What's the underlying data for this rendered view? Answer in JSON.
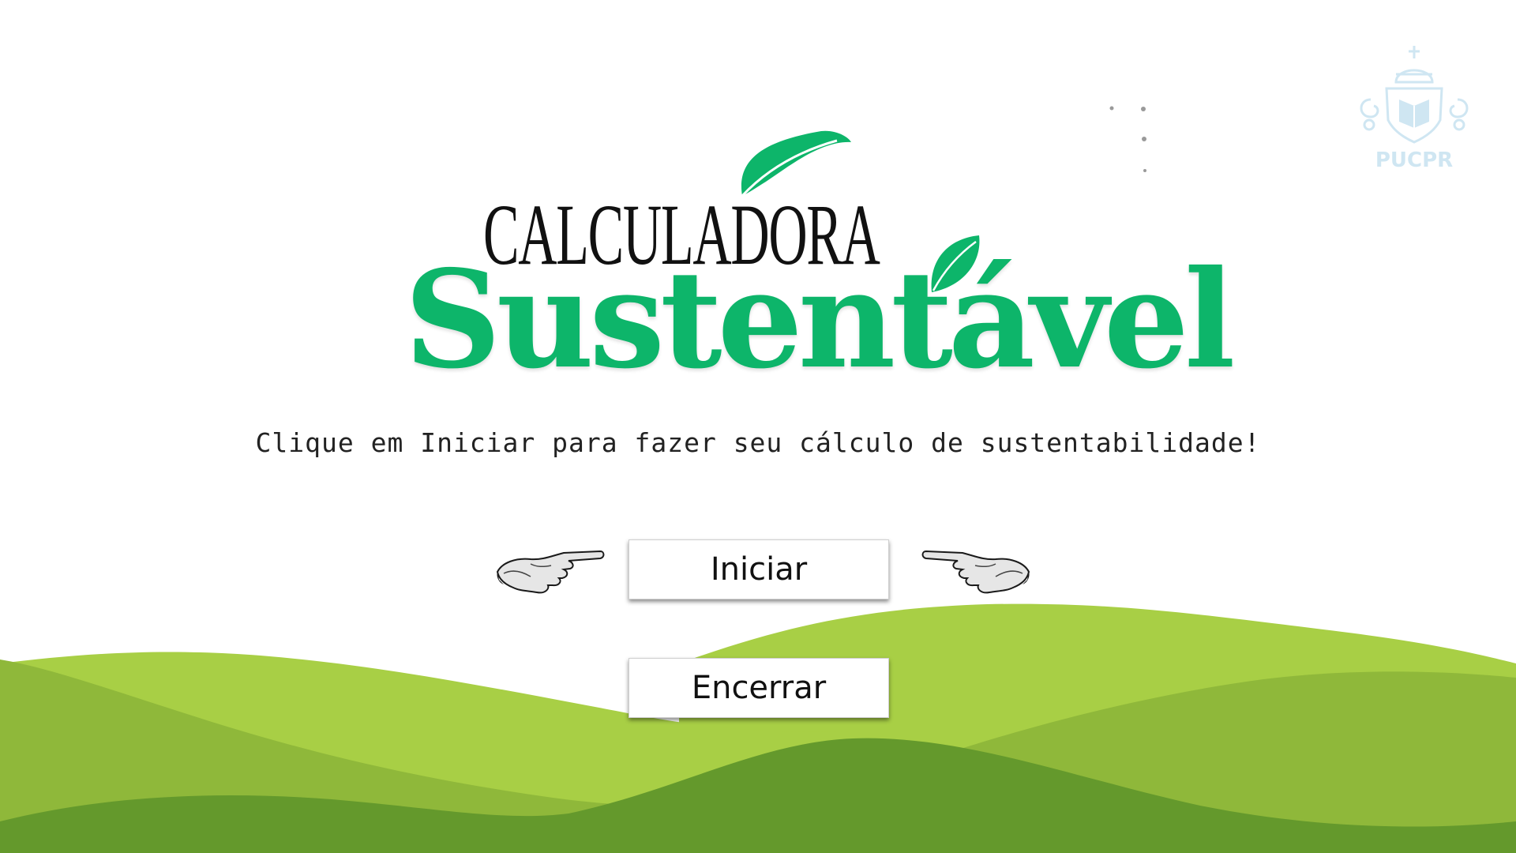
{
  "logo": {
    "line1": "CALCULADORA",
    "line2": "Sustentável"
  },
  "subtitle": "Clique em Iniciar para fazer seu cálculo de sustentabilidade!",
  "buttons": {
    "start_label": "Iniciar",
    "end_label": "Encerrar"
  },
  "emblem": {
    "label": "PUCPR"
  },
  "colors": {
    "brand_green": "#0db56a",
    "hill_light": "#a8cf45",
    "hill_mid": "#8fb83a",
    "hill_dark": "#64992c",
    "emblem_tint": "#cfe6f2"
  },
  "icons": {
    "hand_left": "pointing-hand-right-icon",
    "hand_right": "pointing-hand-left-icon",
    "leaf": "leaf-icon",
    "emblem": "pucpr-crest-icon"
  }
}
